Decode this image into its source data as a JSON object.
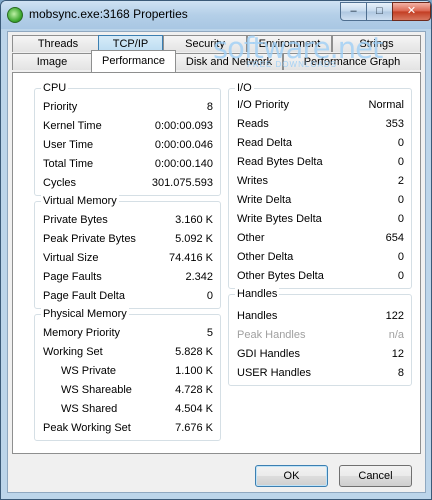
{
  "window": {
    "title": "mobsync.exe:3168 Properties",
    "controls": {
      "minimize": "–",
      "maximize": "□",
      "close": "✕"
    }
  },
  "tabs": {
    "row1": [
      "Threads",
      "TCP/IP",
      "Security",
      "Environment",
      "Strings"
    ],
    "row2": [
      "Image",
      "Performance",
      "Disk and Network",
      "Performance Graph"
    ],
    "active": "Performance"
  },
  "cpu": {
    "title": "CPU",
    "rows": [
      {
        "label": "Priority",
        "value": "8"
      },
      {
        "label": "Kernel Time",
        "value": "0:00:00.093"
      },
      {
        "label": "User Time",
        "value": "0:00:00.046"
      },
      {
        "label": "Total Time",
        "value": "0:00:00.140"
      },
      {
        "label": "Cycles",
        "value": "301.075.593"
      }
    ]
  },
  "virtual_memory": {
    "title": "Virtual Memory",
    "rows": [
      {
        "label": "Private Bytes",
        "value": "3.160 K"
      },
      {
        "label": "Peak Private Bytes",
        "value": "5.092 K"
      },
      {
        "label": "Virtual Size",
        "value": "74.416 K"
      },
      {
        "label": "Page Faults",
        "value": "2.342"
      },
      {
        "label": "Page Fault Delta",
        "value": "0"
      }
    ]
  },
  "physical_memory": {
    "title": "Physical Memory",
    "rows": [
      {
        "label": "Memory Priority",
        "value": "5"
      },
      {
        "label": "Working Set",
        "value": "5.828 K"
      },
      {
        "label": "WS Private",
        "value": "1.100 K"
      },
      {
        "label": "WS Shareable",
        "value": "4.728 K"
      },
      {
        "label": "WS Shared",
        "value": "4.504 K"
      },
      {
        "label": "Peak Working Set",
        "value": "7.676 K"
      }
    ]
  },
  "io": {
    "title": "I/O",
    "rows": [
      {
        "label": "I/O Priority",
        "value": "Normal"
      },
      {
        "label": "Reads",
        "value": "353"
      },
      {
        "label": "Read Delta",
        "value": "0"
      },
      {
        "label": "Read Bytes Delta",
        "value": "0"
      },
      {
        "label": "Writes",
        "value": "2"
      },
      {
        "label": "Write Delta",
        "value": "0"
      },
      {
        "label": "Write Bytes Delta",
        "value": "0"
      },
      {
        "label": "Other",
        "value": "654"
      },
      {
        "label": "Other Delta",
        "value": "0"
      },
      {
        "label": "Other Bytes Delta",
        "value": "0"
      }
    ]
  },
  "handles": {
    "title": "Handles",
    "rows": [
      {
        "label": "Handles",
        "value": "122"
      },
      {
        "label": "Peak Handles",
        "value": "n/a"
      },
      {
        "label": "GDI Handles",
        "value": "12"
      },
      {
        "label": "USER Handles",
        "value": "8"
      }
    ]
  },
  "buttons": {
    "ok": "OK",
    "cancel": "Cancel"
  },
  "watermark": {
    "text": "software.net",
    "sub": "FREE DOWNLOADS"
  },
  "colors": {
    "title_bar": "#b4cfe8",
    "close_button": "#c23c22",
    "group_border": "#d5dfe5"
  }
}
